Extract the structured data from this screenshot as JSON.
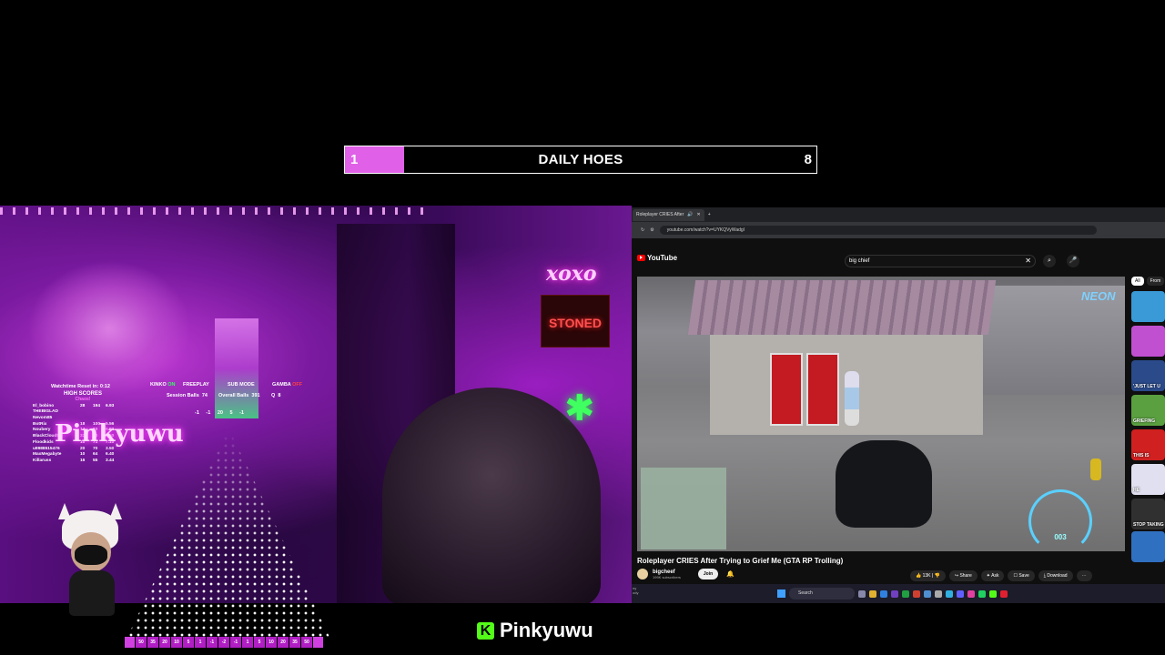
{
  "goal_bar": {
    "current": "1",
    "title": "DAILY HOES",
    "target": "8",
    "progress": 0.125,
    "fill_color": "#e060e8"
  },
  "stream": {
    "neon_signs": [
      "xoxo",
      "STONED"
    ],
    "hud": {
      "watchtime": "Watchtime Reset in: 0:12",
      "kinko_label": "KINKO",
      "kinko_state": "ON",
      "freeplay_label": "FREEPLAY",
      "submode_label": "SUB MODE",
      "gamba_label": "GAMBA",
      "gamba_state": "OFF",
      "session_balls_label": "Session Balls",
      "session_balls": "74",
      "overall_balls_label": "Overall Balls",
      "overall_balls": "391",
      "q_label": "Q",
      "q_value": "8",
      "mini_values": [
        "-1",
        "-1",
        "20",
        "5",
        "-1"
      ]
    },
    "high_scores": {
      "title": "HIGH SCORES",
      "subtitle": "Chaos!",
      "rows": [
        {
          "name": "El_bobino",
          "a": "28",
          "b": "194",
          "c": "6.93"
        },
        {
          "name": "THEBIGLAD",
          "a": "",
          "b": "",
          "c": ""
        },
        {
          "name": "Nevom85",
          "a": "",
          "b": "",
          "c": ""
        },
        {
          "name": "BotRix",
          "a": "18",
          "b": "100",
          "c": "5.56"
        },
        {
          "name": "Noubery",
          "a": "14",
          "b": "83",
          "c": "5.93"
        },
        {
          "name": "BlackCloud52",
          "a": "32",
          "b": "80",
          "c": "2.50"
        },
        {
          "name": "Floodkids",
          "a": "10",
          "b": "71",
          "c": "7.10"
        },
        {
          "name": "u9988515476",
          "a": "20",
          "b": "70",
          "c": "3.50"
        },
        {
          "name": "MaxMegabyte",
          "a": "10",
          "b": "64",
          "c": "6.40"
        },
        {
          "name": "Killaruss",
          "a": "16",
          "b": "55",
          "c": "3.44"
        }
      ]
    },
    "neon_name": "Pinkyuwu",
    "wager_values": [
      "50",
      "35",
      "20",
      "10",
      "5",
      "1",
      "-1",
      "-2",
      "-1",
      "1",
      "5",
      "10",
      "20",
      "35",
      "50"
    ]
  },
  "branding": {
    "platform_icon": "kick-logo",
    "name": "Pinkyuwu",
    "accent": "#53fc18"
  },
  "browser": {
    "tab_title": "Roleplayer CRIES After",
    "url": "youtube.com/watch?v=UYKQVyWadgI",
    "logo": "YouTube",
    "search_value": "big chief",
    "video": {
      "overlay_text": "NEON",
      "title": "Roleplayer CRIES After Trying to Grief Me (GTA RP Trolling)",
      "channel": "bigcheef",
      "subscribers": "199K subscribers",
      "join_label": "Join",
      "likes": "13K",
      "share_label": "Share",
      "ask_label": "Ask",
      "save_label": "Save",
      "download_label": "Download"
    },
    "chips": [
      "All",
      "From"
    ],
    "thumbnails": [
      {
        "caption": "",
        "color": "#3a9ad8"
      },
      {
        "caption": "",
        "color": "#c050d0"
      },
      {
        "caption": "'JUST LET U",
        "color": "#2a4a8a"
      },
      {
        "caption": "GRIEFING",
        "color": "#5aa040"
      },
      {
        "caption": "THIS IS",
        "color": "#d02020"
      },
      {
        "caption": "HE",
        "color": "#e0e0f0"
      },
      {
        "caption": "STOP TAKING",
        "color": "#303030"
      },
      {
        "caption": "",
        "color": "#3070c0"
      }
    ],
    "taskbar": {
      "search_label": "Search",
      "left_text": "ny\nody"
    }
  }
}
